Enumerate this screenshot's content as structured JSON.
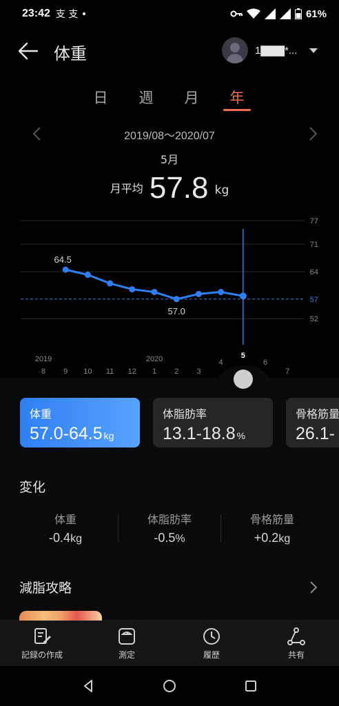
{
  "status_bar": {
    "time": "23:42",
    "notif_glyphs": "支 支 •",
    "battery": "61%"
  },
  "header": {
    "title": "体重",
    "account_name": "1▇▇▇*..."
  },
  "tabs": [
    "日",
    "週",
    "月",
    "年"
  ],
  "active_tab": "年",
  "range": "2019/08～2020/07",
  "selected": {
    "month": "5月",
    "avg_prefix": "月平均",
    "avg_value": "57.8",
    "avg_unit": "kg"
  },
  "chart_data": {
    "type": "line",
    "x": [
      "8",
      "9",
      "10",
      "11",
      "12",
      "1",
      "2",
      "3",
      "4",
      "5",
      "6",
      "7"
    ],
    "year_labels": [
      {
        "label": "2019",
        "at": "8"
      },
      {
        "label": "2020",
        "at": "1"
      }
    ],
    "series": [
      {
        "values": [
          null,
          64.5,
          63.2,
          61.0,
          59.5,
          58.8,
          57.0,
          58.3,
          58.8,
          57.8,
          null,
          null
        ]
      }
    ],
    "y_ticks": [
      77,
      71,
      64,
      57,
      52
    ],
    "ylim": [
      48,
      77
    ],
    "point_labels": [
      {
        "at": "9",
        "text": "64.5"
      },
      {
        "at": "2",
        "text": "57.0"
      }
    ],
    "selected_x": "5",
    "selected_y_tick": 57,
    "grid": true,
    "color": "#2f7ff2"
  },
  "metrics": [
    {
      "title": "体重",
      "value": "57.0-64.5",
      "unit": "kg",
      "active": true
    },
    {
      "title": "体脂肪率",
      "value": "13.1-18.8",
      "unit": "%",
      "active": false
    },
    {
      "title": "骨格筋量",
      "value": "26.1-",
      "unit": "",
      "active": false
    }
  ],
  "changes": {
    "title": "変化",
    "items": [
      {
        "label": "体重",
        "value": "-0.4",
        "unit": "kg"
      },
      {
        "label": "体脂肪率",
        "value": "-0.5",
        "unit": "%"
      },
      {
        "label": "骨格筋量",
        "value": "+0.2",
        "unit": "kg"
      }
    ]
  },
  "tips": {
    "title": "減脂攻略"
  },
  "bottom_nav": [
    {
      "label": "記録の作成",
      "icon": "edit-record-icon"
    },
    {
      "label": "測定",
      "icon": "scale-icon"
    },
    {
      "label": "履歴",
      "icon": "clock-icon"
    },
    {
      "label": "共有",
      "icon": "share-icon"
    }
  ],
  "colors": {
    "accent": "#f26b4a",
    "primary": "#2f7ff2",
    "background": "#000000"
  }
}
